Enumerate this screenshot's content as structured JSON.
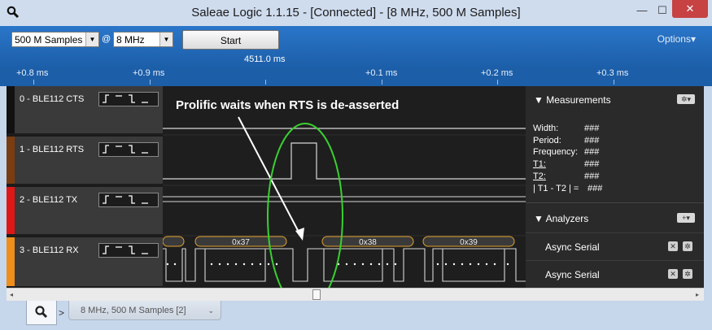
{
  "window": {
    "title": "Saleae Logic 1.1.15 - [Connected] - [8 MHz, 500 M Samples]",
    "min_label": "—",
    "max_label": "☐",
    "close_label": "✕"
  },
  "toolbar": {
    "samples_value": "500 M Samples",
    "at_symbol": "@",
    "rate_value": "8 MHz",
    "start_label": "Start",
    "options_label": "Options▾",
    "trigger_time": "4511.0 ms"
  },
  "ruler": {
    "ticks": [
      "+0.8 ms",
      "+0.9 ms",
      "+0.1 ms",
      "+0.2 ms",
      "+0.3 ms"
    ]
  },
  "channels": [
    {
      "name": "0 - BLE112 CTS",
      "color": "#111111"
    },
    {
      "name": "1 - BLE112 RTS",
      "color": "#7a3d12"
    },
    {
      "name": "2 - BLE112 TX",
      "color": "#e01717"
    },
    {
      "name": "3 - BLE112 RX",
      "color": "#ef8e1a"
    }
  ],
  "annotation": {
    "text": "Prolific waits when RTS is de-asserted"
  },
  "decoded_bytes": [
    "0x37",
    "0x38",
    "0x39"
  ],
  "panel": {
    "measurements_title": "Measurements",
    "measurements": [
      {
        "label": "Width:",
        "value": "###"
      },
      {
        "label": "Period:",
        "value": "###"
      },
      {
        "label": "Frequency:",
        "value": "###"
      },
      {
        "label": "T1:",
        "value": "###"
      },
      {
        "label": "T2:",
        "value": "###"
      },
      {
        "label": "| T1 - T2 | =",
        "value": "###"
      }
    ],
    "analyzers_title": "Analyzers",
    "analyzers": [
      "Async Serial",
      "Async Serial"
    ],
    "add_label": "+▾",
    "gear_label": "✲▾"
  },
  "tabs": {
    "session_label": "8 MHz, 500 M Samples [2]",
    "dropdown_glyph": "⌄",
    "chevron": ">"
  },
  "scroll": {
    "left": "◂",
    "right": "▸"
  },
  "colors": {
    "accent": "#1c5ea8",
    "highlight_circle": "#39d12f",
    "rx_byte_border": "#e0a030"
  }
}
